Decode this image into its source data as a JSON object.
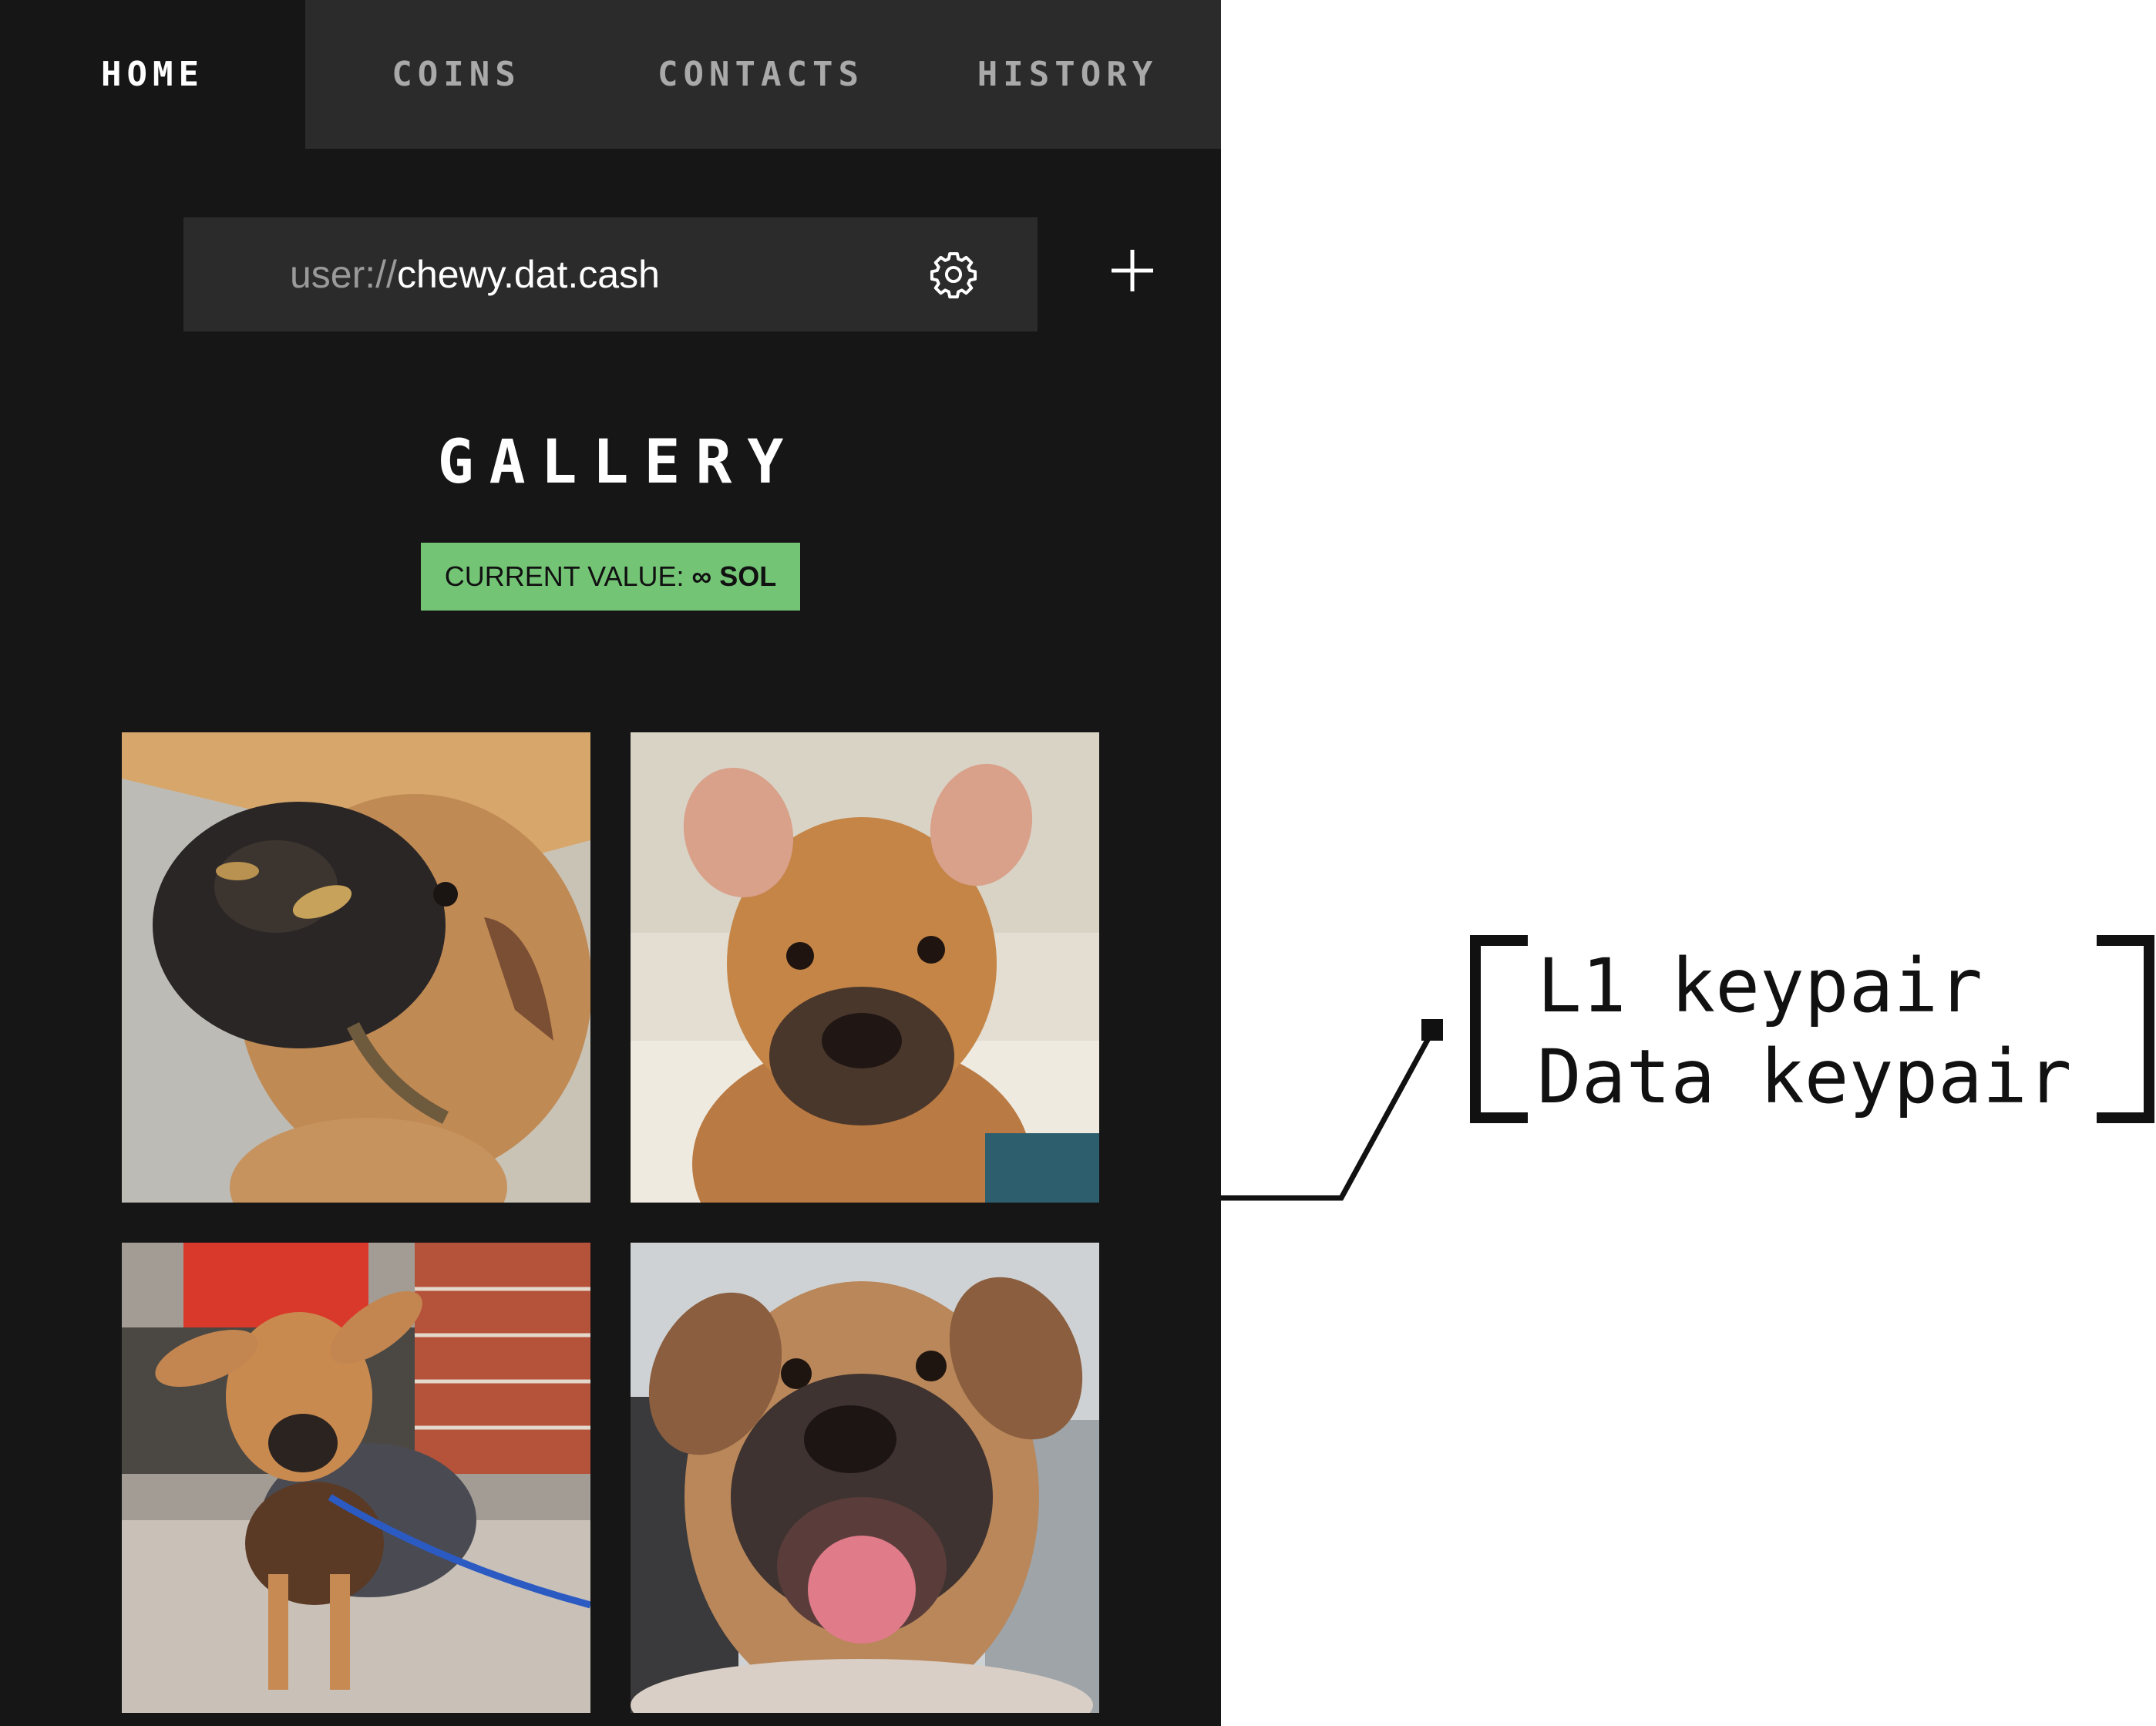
{
  "tabs": [
    {
      "label": "HOME",
      "active": true
    },
    {
      "label": "COINS",
      "active": false
    },
    {
      "label": "CONTACTS",
      "active": false
    },
    {
      "label": "HISTORY",
      "active": false
    }
  ],
  "userbar": {
    "scheme": "user://",
    "host": "chewy.dat.cash",
    "settings_icon": "gear-icon",
    "add_icon": "plus-icon"
  },
  "gallery": {
    "title": "GALLERY",
    "value_label": "CURRENT VALUE:",
    "value_amount": "∞ SOL",
    "photos": [
      {
        "subject": "puppy with muddy snout"
      },
      {
        "subject": "puppy sitting on bed"
      },
      {
        "subject": "puppy in jacket on leash"
      },
      {
        "subject": "puppy smiling close-up"
      }
    ]
  },
  "annotation": {
    "line1": "L1 keypair",
    "line2": "Data keypair"
  },
  "colors": {
    "app_bg": "#161616",
    "bar_bg": "#2b2b2b",
    "badge_green": "#74c476"
  }
}
